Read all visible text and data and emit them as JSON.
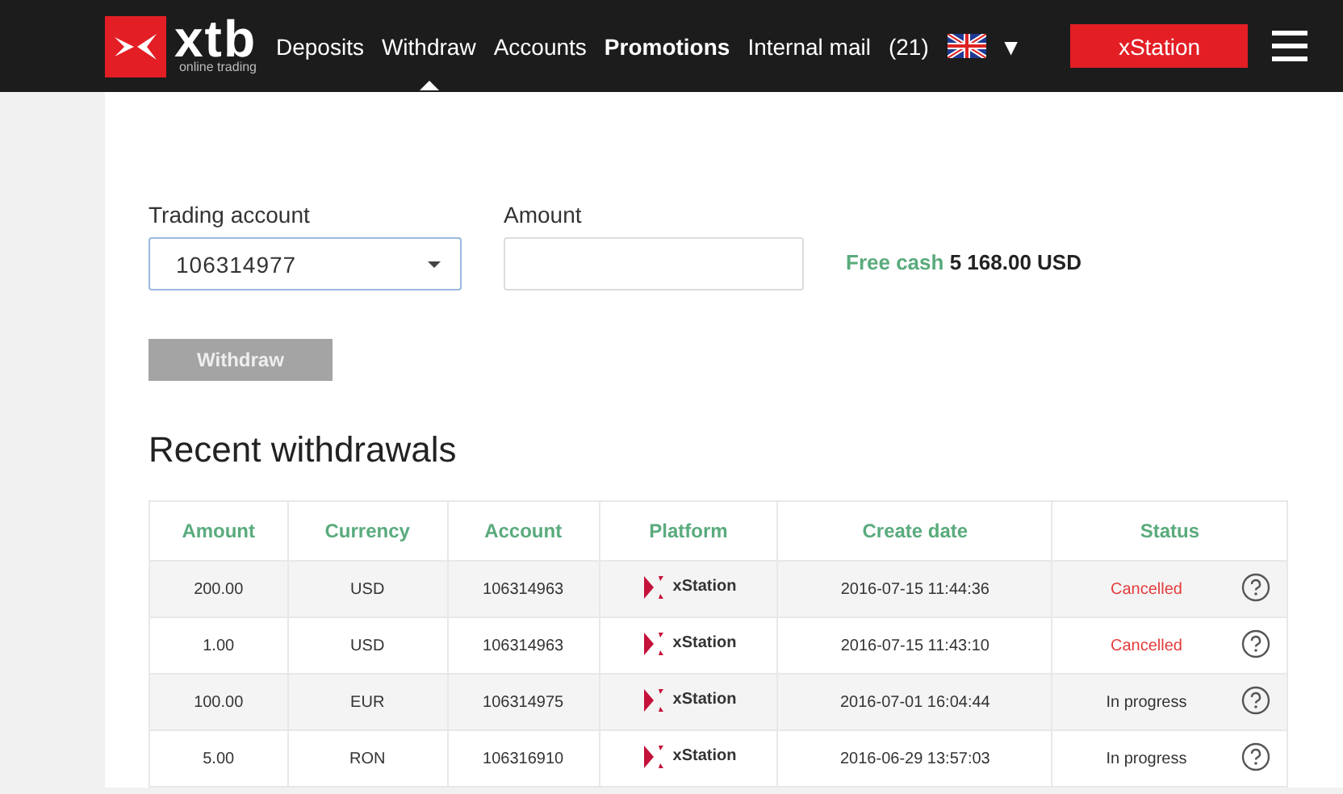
{
  "header": {
    "logo": {
      "name": "xtb",
      "tagline": "online trading"
    },
    "nav": [
      {
        "label": "Deposits",
        "selected": false,
        "bold": false
      },
      {
        "label": "Withdraw",
        "selected": true,
        "bold": false
      },
      {
        "label": "Accounts",
        "selected": false,
        "bold": false
      },
      {
        "label": "Promotions",
        "selected": false,
        "bold": true
      },
      {
        "label": "Internal mail",
        "selected": false,
        "bold": false
      }
    ],
    "mail_count": "(21)",
    "language_caret": "▼",
    "platform_button": "xStation"
  },
  "form": {
    "account": {
      "label": "Trading account",
      "value": "106314977"
    },
    "amount": {
      "label": "Amount"
    },
    "free_cash": {
      "label": "Free cash",
      "value": "5 168.00 USD"
    },
    "submit": {
      "label": "Withdraw",
      "disabled": true
    }
  },
  "recent": {
    "title": "Recent withdrawals",
    "columns": [
      "Amount",
      "Currency",
      "Account",
      "Platform",
      "Create date",
      "Status"
    ],
    "rows": [
      {
        "amount": "200.00",
        "currency": "USD",
        "account": "106314963",
        "platform": "xStation",
        "date": "2016-07-15 11:44:36",
        "status": "Cancelled",
        "kind": "cancelled"
      },
      {
        "amount": "1.00",
        "currency": "USD",
        "account": "106314963",
        "platform": "xStation",
        "date": "2016-07-15 11:43:10",
        "status": "Cancelled",
        "kind": "cancelled"
      },
      {
        "amount": "100.00",
        "currency": "EUR",
        "account": "106314975",
        "platform": "xStation",
        "date": "2016-07-01 16:04:44",
        "status": "In progress",
        "kind": "pending"
      },
      {
        "amount": "5.00",
        "currency": "RON",
        "account": "106316910",
        "platform": "xStation",
        "date": "2016-06-29 13:57:03",
        "status": "In progress",
        "kind": "pending"
      }
    ]
  }
}
